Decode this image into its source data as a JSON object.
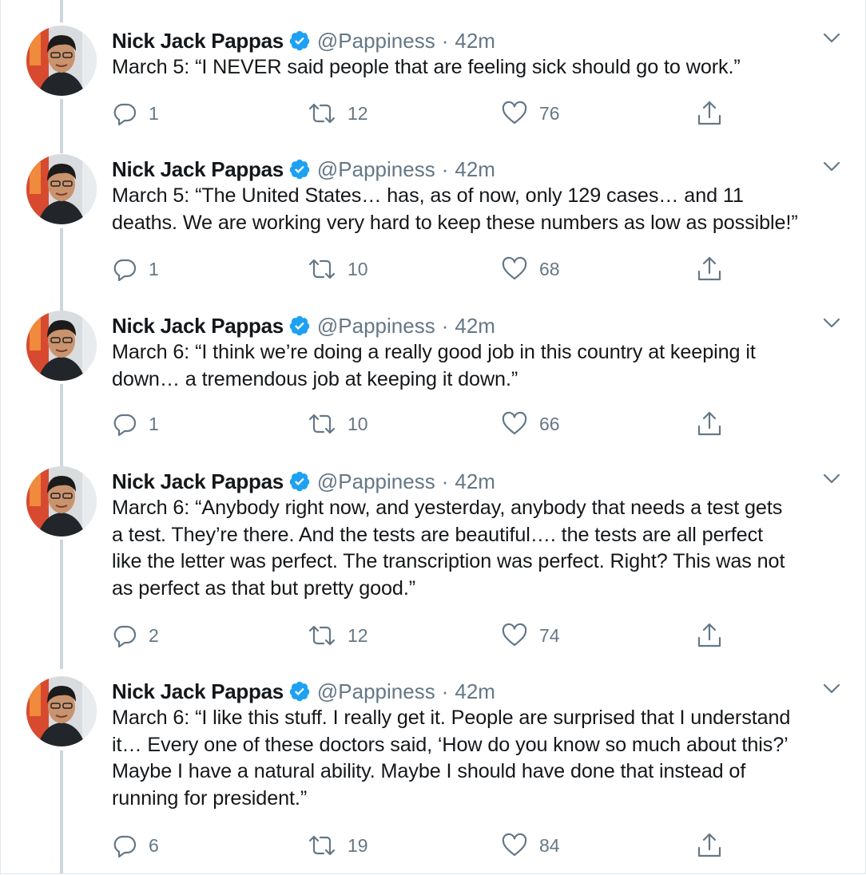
{
  "tweets": [
    {
      "name": "Nick Jack Pappas",
      "handle": "@Pappiness",
      "separator": "·",
      "time": "42m",
      "text": "March 5: “I NEVER said people that are feeling sick should go to work.”",
      "replies": "1",
      "retweets": "12",
      "likes": "76"
    },
    {
      "name": "Nick Jack Pappas",
      "handle": "@Pappiness",
      "separator": "·",
      "time": "42m",
      "text": "March 5: “The United States… has, as of now, only 129 cases… and 11\ndeaths. We are working very hard to keep these numbers as low as possible!”",
      "replies": "1",
      "retweets": "10",
      "likes": "68"
    },
    {
      "name": "Nick Jack Pappas",
      "handle": "@Pappiness",
      "separator": "·",
      "time": "42m",
      "text": "March 6: “I think we’re doing a really good job in this country at keeping it\ndown… a tremendous job at keeping it down.”",
      "replies": "1",
      "retweets": "10",
      "likes": "66"
    },
    {
      "name": "Nick Jack Pappas",
      "handle": "@Pappiness",
      "separator": "·",
      "time": "42m",
      "text": "March 6: “Anybody right now, and yesterday, anybody that needs a test gets\na test. They’re there. And the tests are beautiful…. the tests are all perfect\nlike the letter was perfect. The transcription was perfect. Right? This was not\nas perfect as that but pretty good.”",
      "replies": "2",
      "retweets": "12",
      "likes": "74"
    },
    {
      "name": "Nick Jack Pappas",
      "handle": "@Pappiness",
      "separator": "·",
      "time": "42m",
      "text": "March 6: “I like this stuff. I really get it. People are surprised that I understand\nit… Every one of these doctors said, ‘How do you know so much about this?’\nMaybe I have a natural ability. Maybe I should have done that instead of\nrunning for president.”",
      "replies": "6",
      "retweets": "19",
      "likes": "84"
    }
  ],
  "icons": {
    "reply": "reply-icon",
    "retweet": "retweet-icon",
    "like": "heart-icon",
    "share": "share-icon",
    "verified": "verified-badge-icon",
    "caret": "chevron-down-icon"
  },
  "colors": {
    "text": "#14171a",
    "secondary": "#657786",
    "verified": "#1da1f2",
    "thread_line": "#ccd6dd"
  }
}
